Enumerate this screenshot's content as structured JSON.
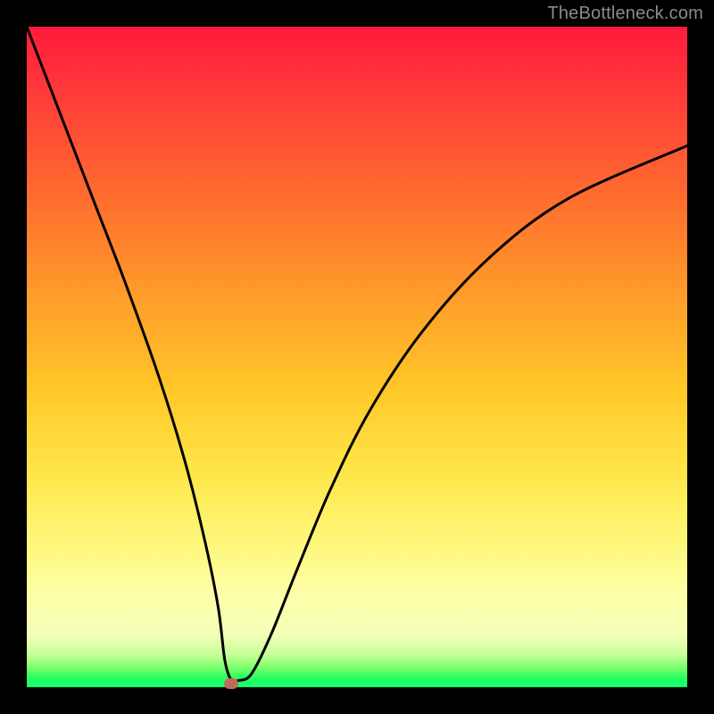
{
  "watermark": {
    "text": "TheBottleneck.com"
  },
  "colors": {
    "background": "#000000",
    "curve": "#000000",
    "dot": "#c06a5a",
    "gradient_stops": [
      "#ff1a3c",
      "#ff3a3a",
      "#ff6a2f",
      "#ff9a2a",
      "#ffc728",
      "#ffe74a",
      "#fff77a",
      "#fdffa8",
      "#f3ffb8",
      "#c9ff9a",
      "#7dff6b",
      "#2cff5e",
      "#11ff70"
    ]
  },
  "chart_data": {
    "type": "line",
    "title": "",
    "xlabel": "",
    "ylabel": "",
    "xlim": [
      0,
      100
    ],
    "ylim": [
      0,
      100
    ],
    "series": [
      {
        "name": "bottleneck-curve",
        "x": [
          0,
          5,
          10,
          15,
          20,
          24,
          27,
          29,
          30,
          31,
          32,
          34,
          37,
          41,
          46,
          52,
          60,
          70,
          82,
          100
        ],
        "y": [
          100,
          87,
          74,
          61,
          47,
          34,
          22,
          12,
          4,
          1,
          1,
          2,
          8,
          18,
          30,
          42,
          54,
          65,
          74,
          82
        ]
      }
    ],
    "marker": {
      "x": 31,
      "y": 0.5,
      "name": "optimal-point"
    }
  }
}
